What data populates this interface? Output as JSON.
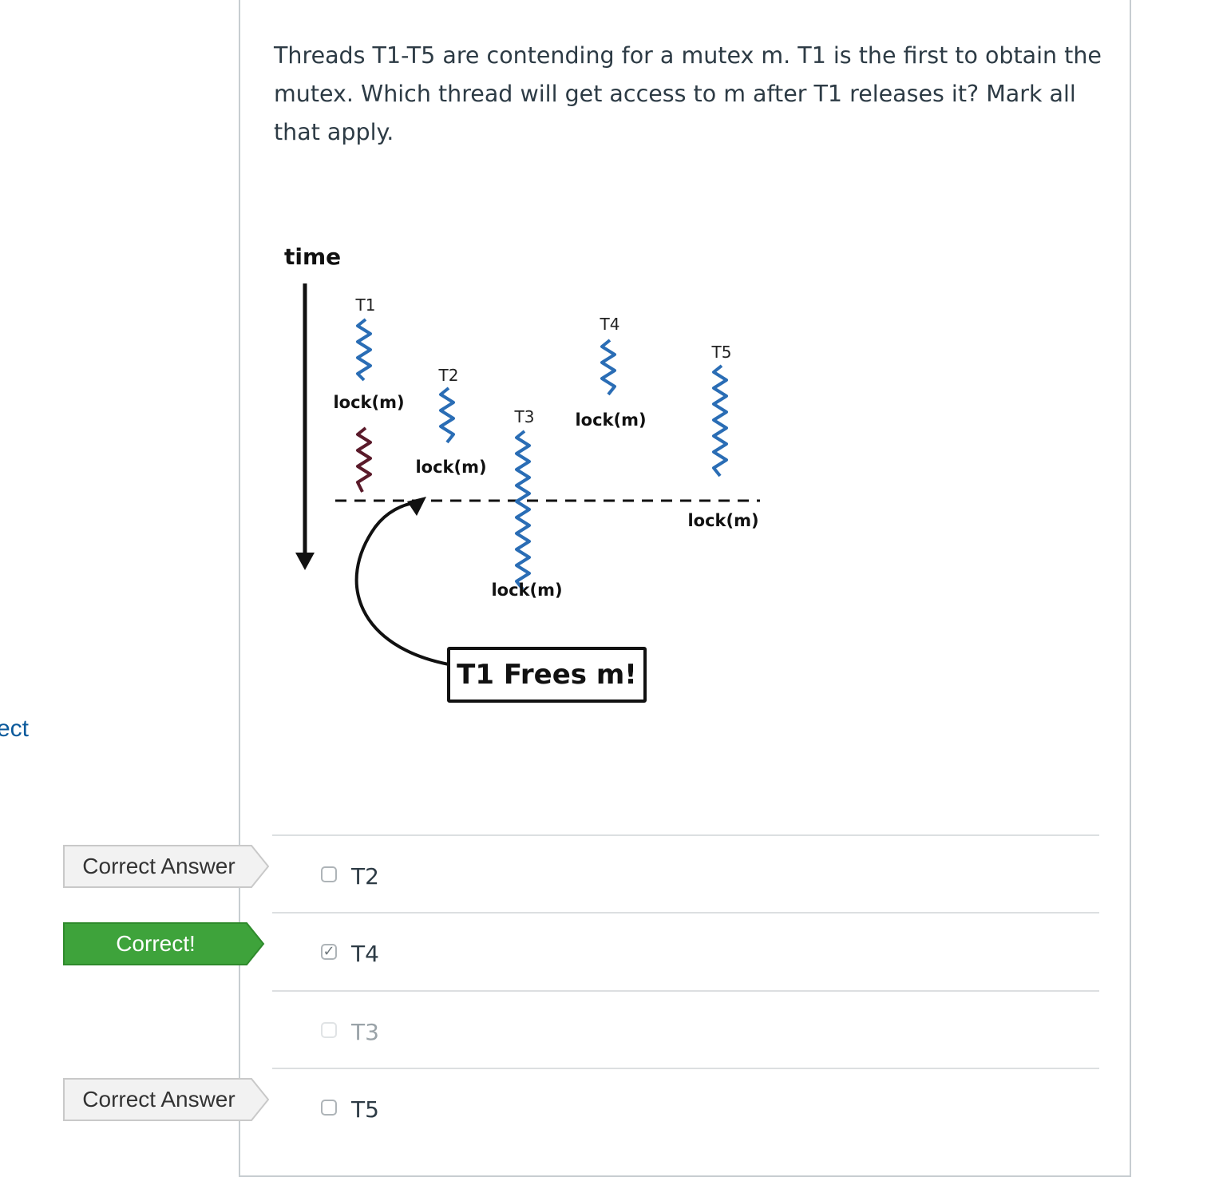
{
  "left_link": {
    "text": "ect"
  },
  "question": {
    "text": "Threads T1-T5 are contending for a mutex m. T1 is the first to obtain the mutex. Which thread will get access to m after T1 releases it? Mark all that apply."
  },
  "diagram": {
    "time_label": "time",
    "threads": [
      "T1",
      "T2",
      "T3",
      "T4",
      "T5"
    ],
    "lock_label": "lock(m)",
    "frees_label": "T1 Frees m!",
    "colors": {
      "thread_line": "#2a6db5",
      "t1_critical": "#5a1a2a",
      "ink": "#111111"
    }
  },
  "answers": [
    {
      "label": "T2",
      "checked": false,
      "flag": "Correct Answer",
      "flag_type": "correct-answer"
    },
    {
      "label": "T4",
      "checked": true,
      "flag": "Correct!",
      "flag_type": "correct"
    },
    {
      "label": "T3",
      "checked": false,
      "flag": "",
      "flag_type": "none"
    },
    {
      "label": "T5",
      "checked": false,
      "flag": "Correct Answer",
      "flag_type": "correct-answer"
    }
  ],
  "colors": {
    "green_flag": "#3ea33b",
    "grey_flag": "#f2f2f2",
    "link": "#0b5a9c"
  }
}
